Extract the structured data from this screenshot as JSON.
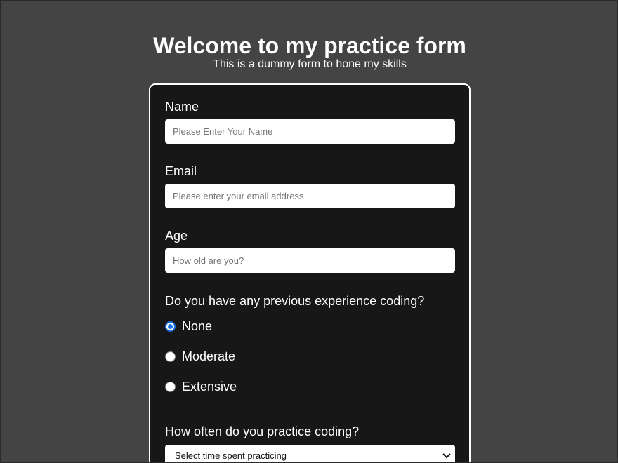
{
  "header": {
    "title": "Welcome to my practice form",
    "subtitle": "This is a dummy form to hone my skills"
  },
  "form": {
    "name": {
      "label": "Name",
      "placeholder": "Please Enter Your Name"
    },
    "email": {
      "label": "Email",
      "placeholder": "Please enter your email address"
    },
    "age": {
      "label": "Age",
      "placeholder": "How old are you?"
    },
    "experience": {
      "question": "Do you have any previous experience coding?",
      "options": [
        {
          "label": "None",
          "checked": true
        },
        {
          "label": "Moderate",
          "checked": false
        },
        {
          "label": "Extensive",
          "checked": false
        }
      ]
    },
    "frequency": {
      "question": "How often do you practice coding?",
      "selected": "Select time spent practicing"
    }
  },
  "colors": {
    "page_background": "#454445",
    "card_background": "#171717",
    "radio_accent": "#1a73e8"
  },
  "icons": {
    "select_arrow": "chevron-down-icon"
  }
}
